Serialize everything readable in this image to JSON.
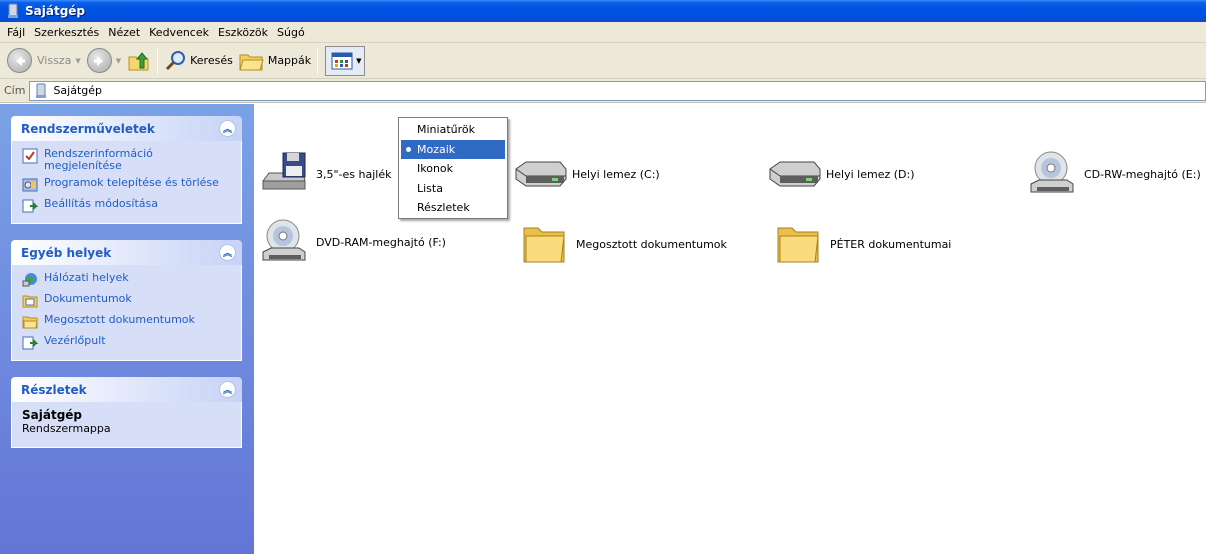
{
  "window": {
    "title": "Sajátgép"
  },
  "menubar": {
    "items": [
      "Fájl",
      "Szerkesztés",
      "Nézet",
      "Kedvencek",
      "Eszközök",
      "Súgó"
    ]
  },
  "toolbar": {
    "back_label": "Vissza",
    "search_label": "Keresés",
    "folders_label": "Mappák"
  },
  "address": {
    "label": "Cím",
    "value": "Sajátgép"
  },
  "view_menu": {
    "items": [
      "Miniatűrök",
      "Mozaik",
      "Ikonok",
      "Lista",
      "Részletek"
    ],
    "selected": "Mozaik"
  },
  "sidebar": {
    "system_tasks": {
      "title": "Rendszerműveletek",
      "items": [
        {
          "label": "Rendszerinformáció megjelenítése",
          "icon": "system-info-icon"
        },
        {
          "label": "Programok telepítése és törlése",
          "icon": "add-remove-programs-icon"
        },
        {
          "label": "Beállítás módosítása",
          "icon": "control-panel-icon"
        }
      ]
    },
    "other_places": {
      "title": "Egyéb helyek",
      "items": [
        {
          "label": "Hálózati helyek",
          "icon": "network-places-icon"
        },
        {
          "label": "Dokumentumok",
          "icon": "documents-icon"
        },
        {
          "label": "Megosztott dokumentumok",
          "icon": "shared-folder-icon"
        },
        {
          "label": "Vezérlőpult",
          "icon": "control-panel-icon"
        }
      ]
    },
    "details": {
      "title": "Részletek",
      "name": "Sajátgép",
      "type": "Rendszermappa"
    }
  },
  "items": [
    {
      "label": "3,5\"-es hajlék",
      "icon": "floppy-drive-icon"
    },
    {
      "label": "Helyi lemez (C:)",
      "icon": "hard-disk-icon"
    },
    {
      "label": "Helyi lemez (D:)",
      "icon": "hard-disk-icon"
    },
    {
      "label": "CD-RW-meghajtó (E:)",
      "icon": "cd-drive-icon"
    },
    {
      "label": "DVD-RAM-meghajtó (F:)",
      "icon": "cd-drive-icon"
    },
    {
      "label": "Megosztott dokumentumok",
      "icon": "folder-icon"
    },
    {
      "label": "PÉTER dokumentumai",
      "icon": "folder-icon"
    }
  ],
  "colors": {
    "titlebar": "#0054e3",
    "sidebar_bg": "#7ba2e7",
    "link": "#215dc6",
    "selection": "#316ac5"
  }
}
